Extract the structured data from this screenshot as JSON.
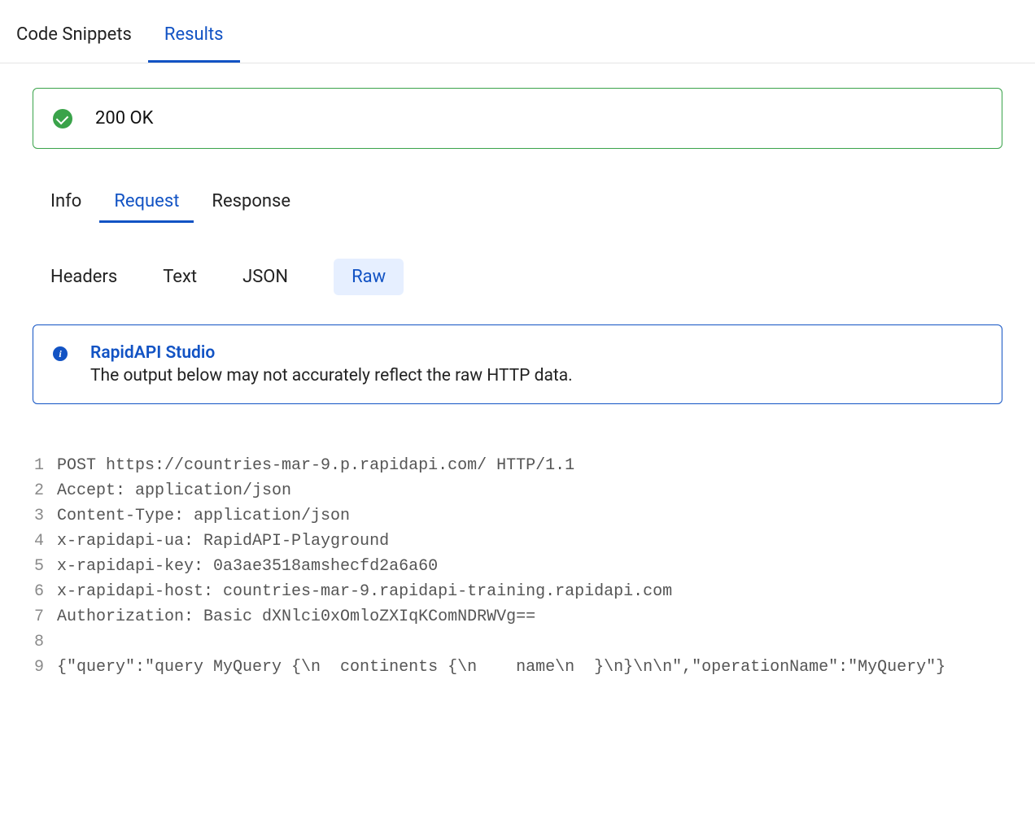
{
  "top_tabs": {
    "code_snippets": "Code Snippets",
    "results": "Results"
  },
  "status": {
    "text": "200 OK"
  },
  "sub_tabs": {
    "info": "Info",
    "request": "Request",
    "response": "Response"
  },
  "format_tabs": {
    "headers": "Headers",
    "text": "Text",
    "json": "JSON",
    "raw": "Raw"
  },
  "info_box": {
    "title": "RapidAPI Studio",
    "text": "The output below may not accurately reflect the raw HTTP data."
  },
  "code": {
    "l1": "POST https://countries-mar-9.p.rapidapi.com/ HTTP/1.1",
    "l2": "Accept: application/json",
    "l3": "Content-Type: application/json",
    "l4": "x-rapidapi-ua: RapidAPI-Playground",
    "l5": "x-rapidapi-key: 0a3ae3518amshecfd2a6a60",
    "l6": "x-rapidapi-host: countries-mar-9.rapidapi-training.rapidapi.com",
    "l7": "Authorization: Basic dXNlci0xOmloZXIqKComNDRWVg==",
    "l8": "",
    "l9": "{\"query\":\"query MyQuery {\\n  continents {\\n    name\\n  }\\n}\\n\\n\",\"operationName\":\"MyQuery\"}"
  },
  "line_numbers": {
    "n1": "1",
    "n2": "2",
    "n3": "3",
    "n4": "4",
    "n5": "5",
    "n6": "6",
    "n7": "7",
    "n8": "8",
    "n9": "9"
  }
}
